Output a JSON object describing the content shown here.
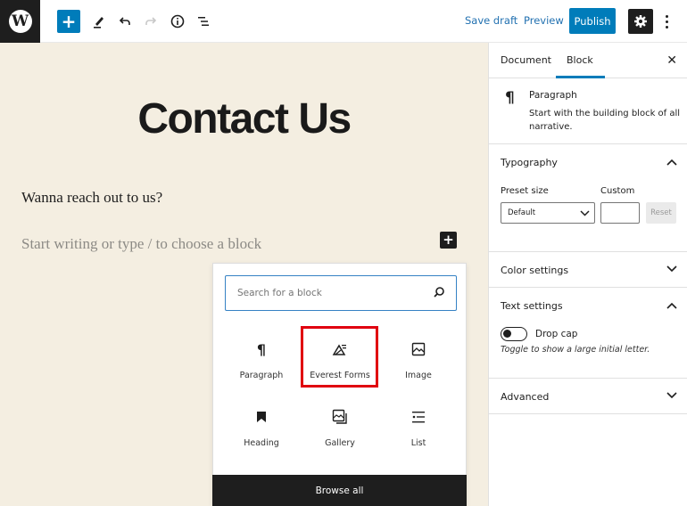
{
  "topbar": {
    "logo_icon": "wordpress-logo",
    "add_block_icon": "plus-icon",
    "tools_icon": "pencil-icon",
    "undo_icon": "undo-icon",
    "redo_icon": "redo-icon",
    "info_icon": "info-icon",
    "outline_icon": "list-view-icon",
    "save_draft": "Save draft",
    "preview": "Preview",
    "publish": "Publish",
    "settings_icon": "gear-icon",
    "more_icon": "vertical-ellipsis-icon"
  },
  "editor": {
    "title": "Contact Us",
    "paragraph": "Wanna reach out to us?",
    "placeholder": "Start writing or type / to choose a block",
    "inline_add_icon": "plus-icon"
  },
  "inserter": {
    "search_placeholder": "Search for a block",
    "search_value": "",
    "blocks": [
      {
        "label": "Paragraph",
        "icon": "pilcrow-icon"
      },
      {
        "label": "Everest Forms",
        "icon": "everest-forms-icon",
        "highlighted": true
      },
      {
        "label": "Image",
        "icon": "image-icon"
      },
      {
        "label": "Heading",
        "icon": "bookmark-icon"
      },
      {
        "label": "Gallery",
        "icon": "gallery-icon"
      },
      {
        "label": "List",
        "icon": "list-icon"
      }
    ],
    "browse_all": "Browse all",
    "highlight_color": "#e0000f"
  },
  "sidebar": {
    "tabs": [
      {
        "label": "Document",
        "active": false
      },
      {
        "label": "Block",
        "active": true
      }
    ],
    "close_icon": "close-icon",
    "block_card": {
      "name": "Paragraph",
      "description": "Start with the building block of all narrative."
    },
    "typography": {
      "title": "Typography",
      "expanded": true,
      "preset_label": "Preset size",
      "preset_value": "Default",
      "custom_label": "Custom",
      "custom_value": "",
      "reset": "Reset"
    },
    "color_settings": {
      "title": "Color settings",
      "expanded": false
    },
    "text_settings": {
      "title": "Text settings",
      "expanded": true,
      "drop_cap_label": "Drop cap",
      "drop_cap_on": false,
      "help": "Toggle to show a large initial letter."
    },
    "advanced": {
      "title": "Advanced",
      "expanded": false
    }
  },
  "colors": {
    "accent": "#007cba",
    "canvas_bg": "#f4eee1",
    "dark": "#1e1e1e"
  }
}
